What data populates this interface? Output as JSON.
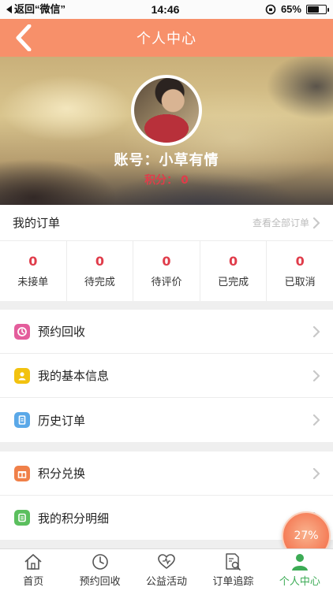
{
  "status_bar": {
    "back_text": "返回“微信”",
    "time": "14:46",
    "battery_text": "65%",
    "battery_level": 0.65
  },
  "nav": {
    "title": "个人中心"
  },
  "profile": {
    "account_label": "账号：小草有情",
    "points_label": "积分：",
    "points_value": "0"
  },
  "orders": {
    "title": "我的订单",
    "view_all": "查看全部订单",
    "stats": [
      {
        "count": "0",
        "label": "未接单"
      },
      {
        "count": "0",
        "label": "待完成"
      },
      {
        "count": "0",
        "label": "待评价"
      },
      {
        "count": "0",
        "label": "已完成"
      },
      {
        "count": "0",
        "label": "已取消"
      }
    ]
  },
  "menu_group_1": [
    {
      "label": "预约回收",
      "icon": "clock-icon",
      "color": "#e45d9c"
    },
    {
      "label": "我的基本信息",
      "icon": "person-icon",
      "color": "#f2c20f"
    },
    {
      "label": "历史订单",
      "icon": "document-icon",
      "color": "#5aa8e8"
    }
  ],
  "menu_group_2": [
    {
      "label": "积分兑换",
      "icon": "gift-icon",
      "color": "#f08049"
    },
    {
      "label": "我的积分明细",
      "icon": "list-icon",
      "color": "#5bbf5e"
    }
  ],
  "bubble": {
    "text": "27%"
  },
  "tabs": [
    {
      "label": "首页",
      "icon": "home-icon",
      "active": false
    },
    {
      "label": "预约回收",
      "icon": "clock-icon",
      "active": false
    },
    {
      "label": "公益活动",
      "icon": "heart-icon",
      "active": false
    },
    {
      "label": "订单追踪",
      "icon": "order-search-icon",
      "active": false
    },
    {
      "label": "个人中心",
      "icon": "user-icon",
      "active": true
    }
  ],
  "colors": {
    "accent": "#f7906a",
    "count_red": "#e03c4a",
    "active_green": "#3cab55"
  }
}
